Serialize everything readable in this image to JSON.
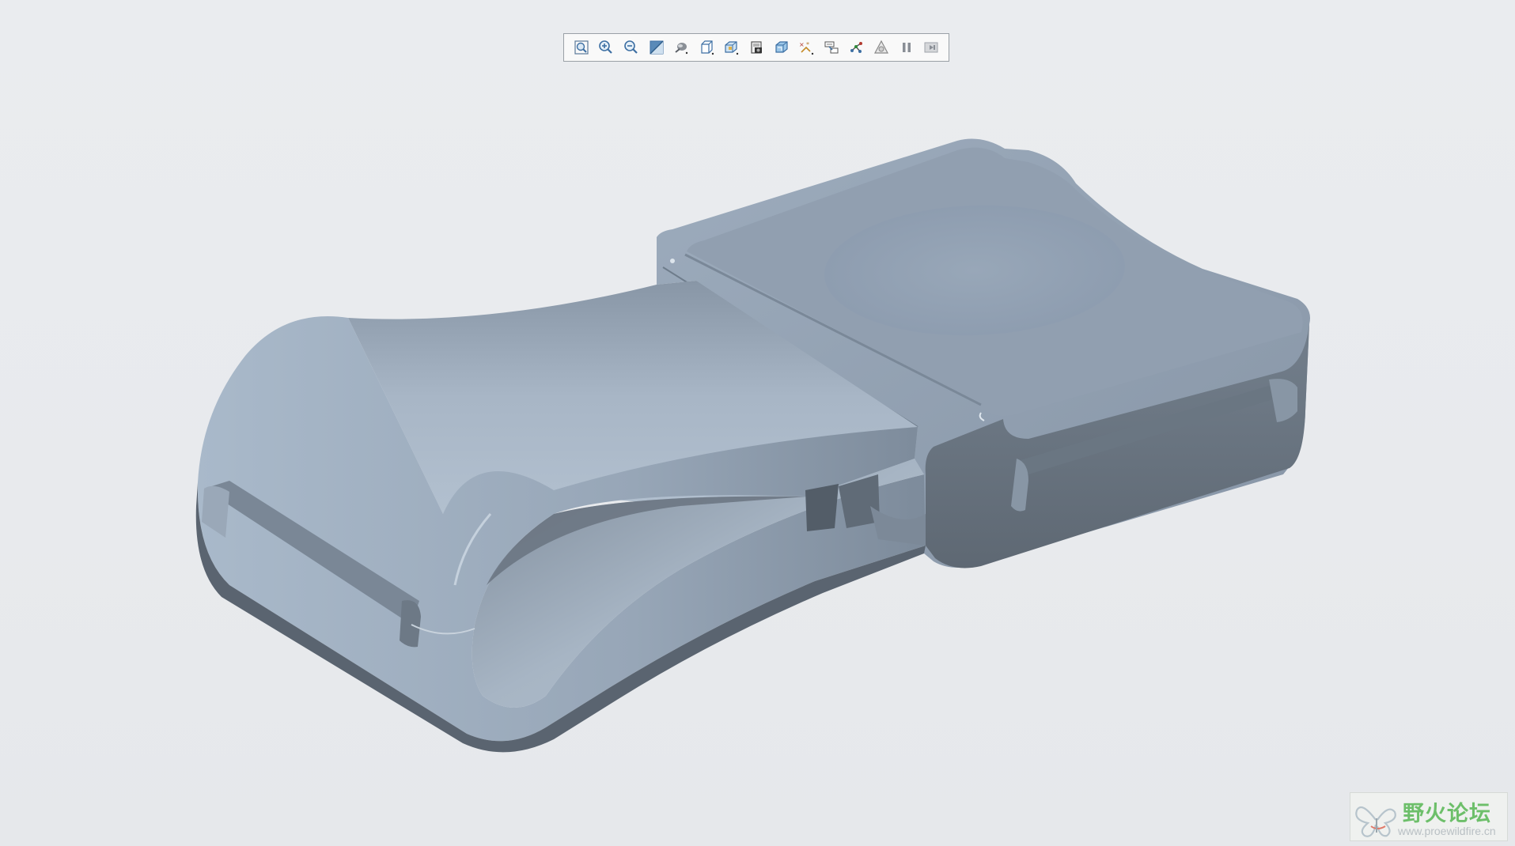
{
  "toolbar": {
    "buttons": [
      {
        "name": "refit-icon"
      },
      {
        "name": "zoom-in-icon"
      },
      {
        "name": "zoom-out-icon"
      },
      {
        "name": "repaint-icon"
      },
      {
        "name": "display-style-icon"
      },
      {
        "name": "saved-orientations-icon"
      },
      {
        "name": "view-manager-icon"
      },
      {
        "name": "perspective-view-icon"
      },
      {
        "name": "section-icon"
      },
      {
        "name": "datum-display-icon"
      },
      {
        "name": "annotation-display-icon"
      },
      {
        "name": "spin-center-icon"
      },
      {
        "name": "appearance-icon"
      },
      {
        "name": "pause-icon"
      },
      {
        "name": "next-icon"
      }
    ]
  },
  "watermark": {
    "title": "野火论坛",
    "url": "www.proewildfire.cn"
  },
  "colors": {
    "background": "#e8eaed",
    "model_light": "#a9b8c8",
    "model_mid": "#8a99aa",
    "model_dark": "#5c6670",
    "watermark_green": "#6dbf6a"
  }
}
